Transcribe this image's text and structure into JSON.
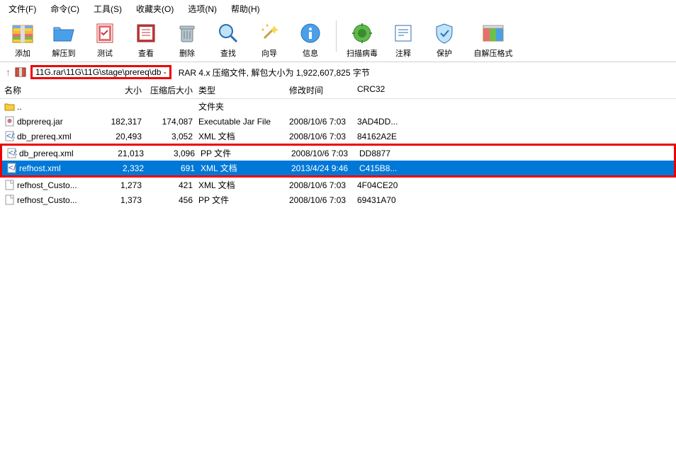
{
  "menu": {
    "file": "文件(F)",
    "command": "命令(C)",
    "tools": "工具(S)",
    "favorites": "收藏夹(O)",
    "options": "选项(N)",
    "help": "帮助(H)"
  },
  "toolbar": {
    "add": "添加",
    "extract": "解压到",
    "test": "测试",
    "view": "查看",
    "delete": "删除",
    "find": "查找",
    "wizard": "向导",
    "info": "信息",
    "scan": "扫描病毒",
    "comment": "注释",
    "protect": "保护",
    "sfx": "自解压格式"
  },
  "pathbar": {
    "highlighted_path": "11G.rar\\11G\\11G\\stage\\prereq\\db -",
    "status": "RAR 4.x 压缩文件, 解包大小为 1,922,607,825 字节"
  },
  "columns": {
    "name": "名称",
    "size": "大小",
    "packed": "压缩后大小",
    "type": "类型",
    "modified": "修改时间",
    "crc": "CRC32"
  },
  "rows": [
    {
      "icon": "folder-up",
      "name": "..",
      "size": "",
      "packed": "",
      "type": "文件夹",
      "modified": "",
      "crc": "",
      "selected": false,
      "highlight": false
    },
    {
      "icon": "jar",
      "name": "dbprereq.jar",
      "size": "182,317",
      "packed": "174,087",
      "type": "Executable Jar File",
      "modified": "2008/10/6 7:03",
      "crc": "3AD4DD...",
      "selected": false,
      "highlight": false
    },
    {
      "icon": "xml",
      "name": "db_prereq.xml",
      "size": "20,493",
      "packed": "3,052",
      "type": "XML 文档",
      "modified": "2008/10/6 7:03",
      "crc": "84162A2E",
      "selected": false,
      "highlight": false
    },
    {
      "icon": "xml",
      "name": "db_prereq.xml",
      "size": "21,013",
      "packed": "3,096",
      "type": "PP 文件",
      "modified": "2008/10/6 7:03",
      "crc": "DD8877",
      "selected": false,
      "highlight": true
    },
    {
      "icon": "xml",
      "name": "refhost.xml",
      "size": "2,332",
      "packed": "691",
      "type": "XML 文档",
      "modified": "2013/4/24 9:46",
      "crc": "C415B8...",
      "selected": true,
      "highlight": true
    },
    {
      "icon": "file",
      "name": "refhost_Custo...",
      "size": "1,273",
      "packed": "421",
      "type": "XML 文档",
      "modified": "2008/10/6 7:03",
      "crc": "4F04CE20",
      "selected": false,
      "highlight": false
    },
    {
      "icon": "file",
      "name": "refhost_Custo...",
      "size": "1,373",
      "packed": "456",
      "type": "PP 文件",
      "modified": "2008/10/6 7:03",
      "crc": "69431A70",
      "selected": false,
      "highlight": false
    }
  ]
}
